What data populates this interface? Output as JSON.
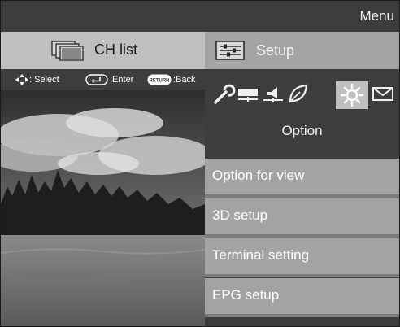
{
  "header": {
    "title": "Menu"
  },
  "tabs": {
    "ch_list": {
      "label": "CH list",
      "icon": "tv-stack-icon"
    },
    "setup": {
      "label": "Setup",
      "icon": "sliders-icon"
    }
  },
  "hints": {
    "select": ": Select",
    "enter": ":Enter",
    "back": ":Back",
    "return_badge": "RETURN"
  },
  "categories": {
    "icons": [
      "wrench-icon",
      "picture-bar-icon",
      "speaker-icon",
      "leaf-icon",
      "option-gear-icon",
      "mail-icon"
    ],
    "selected_label": "Option"
  },
  "menu": {
    "items": [
      "Option for view",
      "3D setup",
      "Terminal setting",
      "EPG setup"
    ]
  },
  "colors": {
    "background": "#3d3d3d",
    "tab_active": "#bfbfbf",
    "tab_setup": "#a4a4a4",
    "menu_item": "#a3a3a3"
  }
}
